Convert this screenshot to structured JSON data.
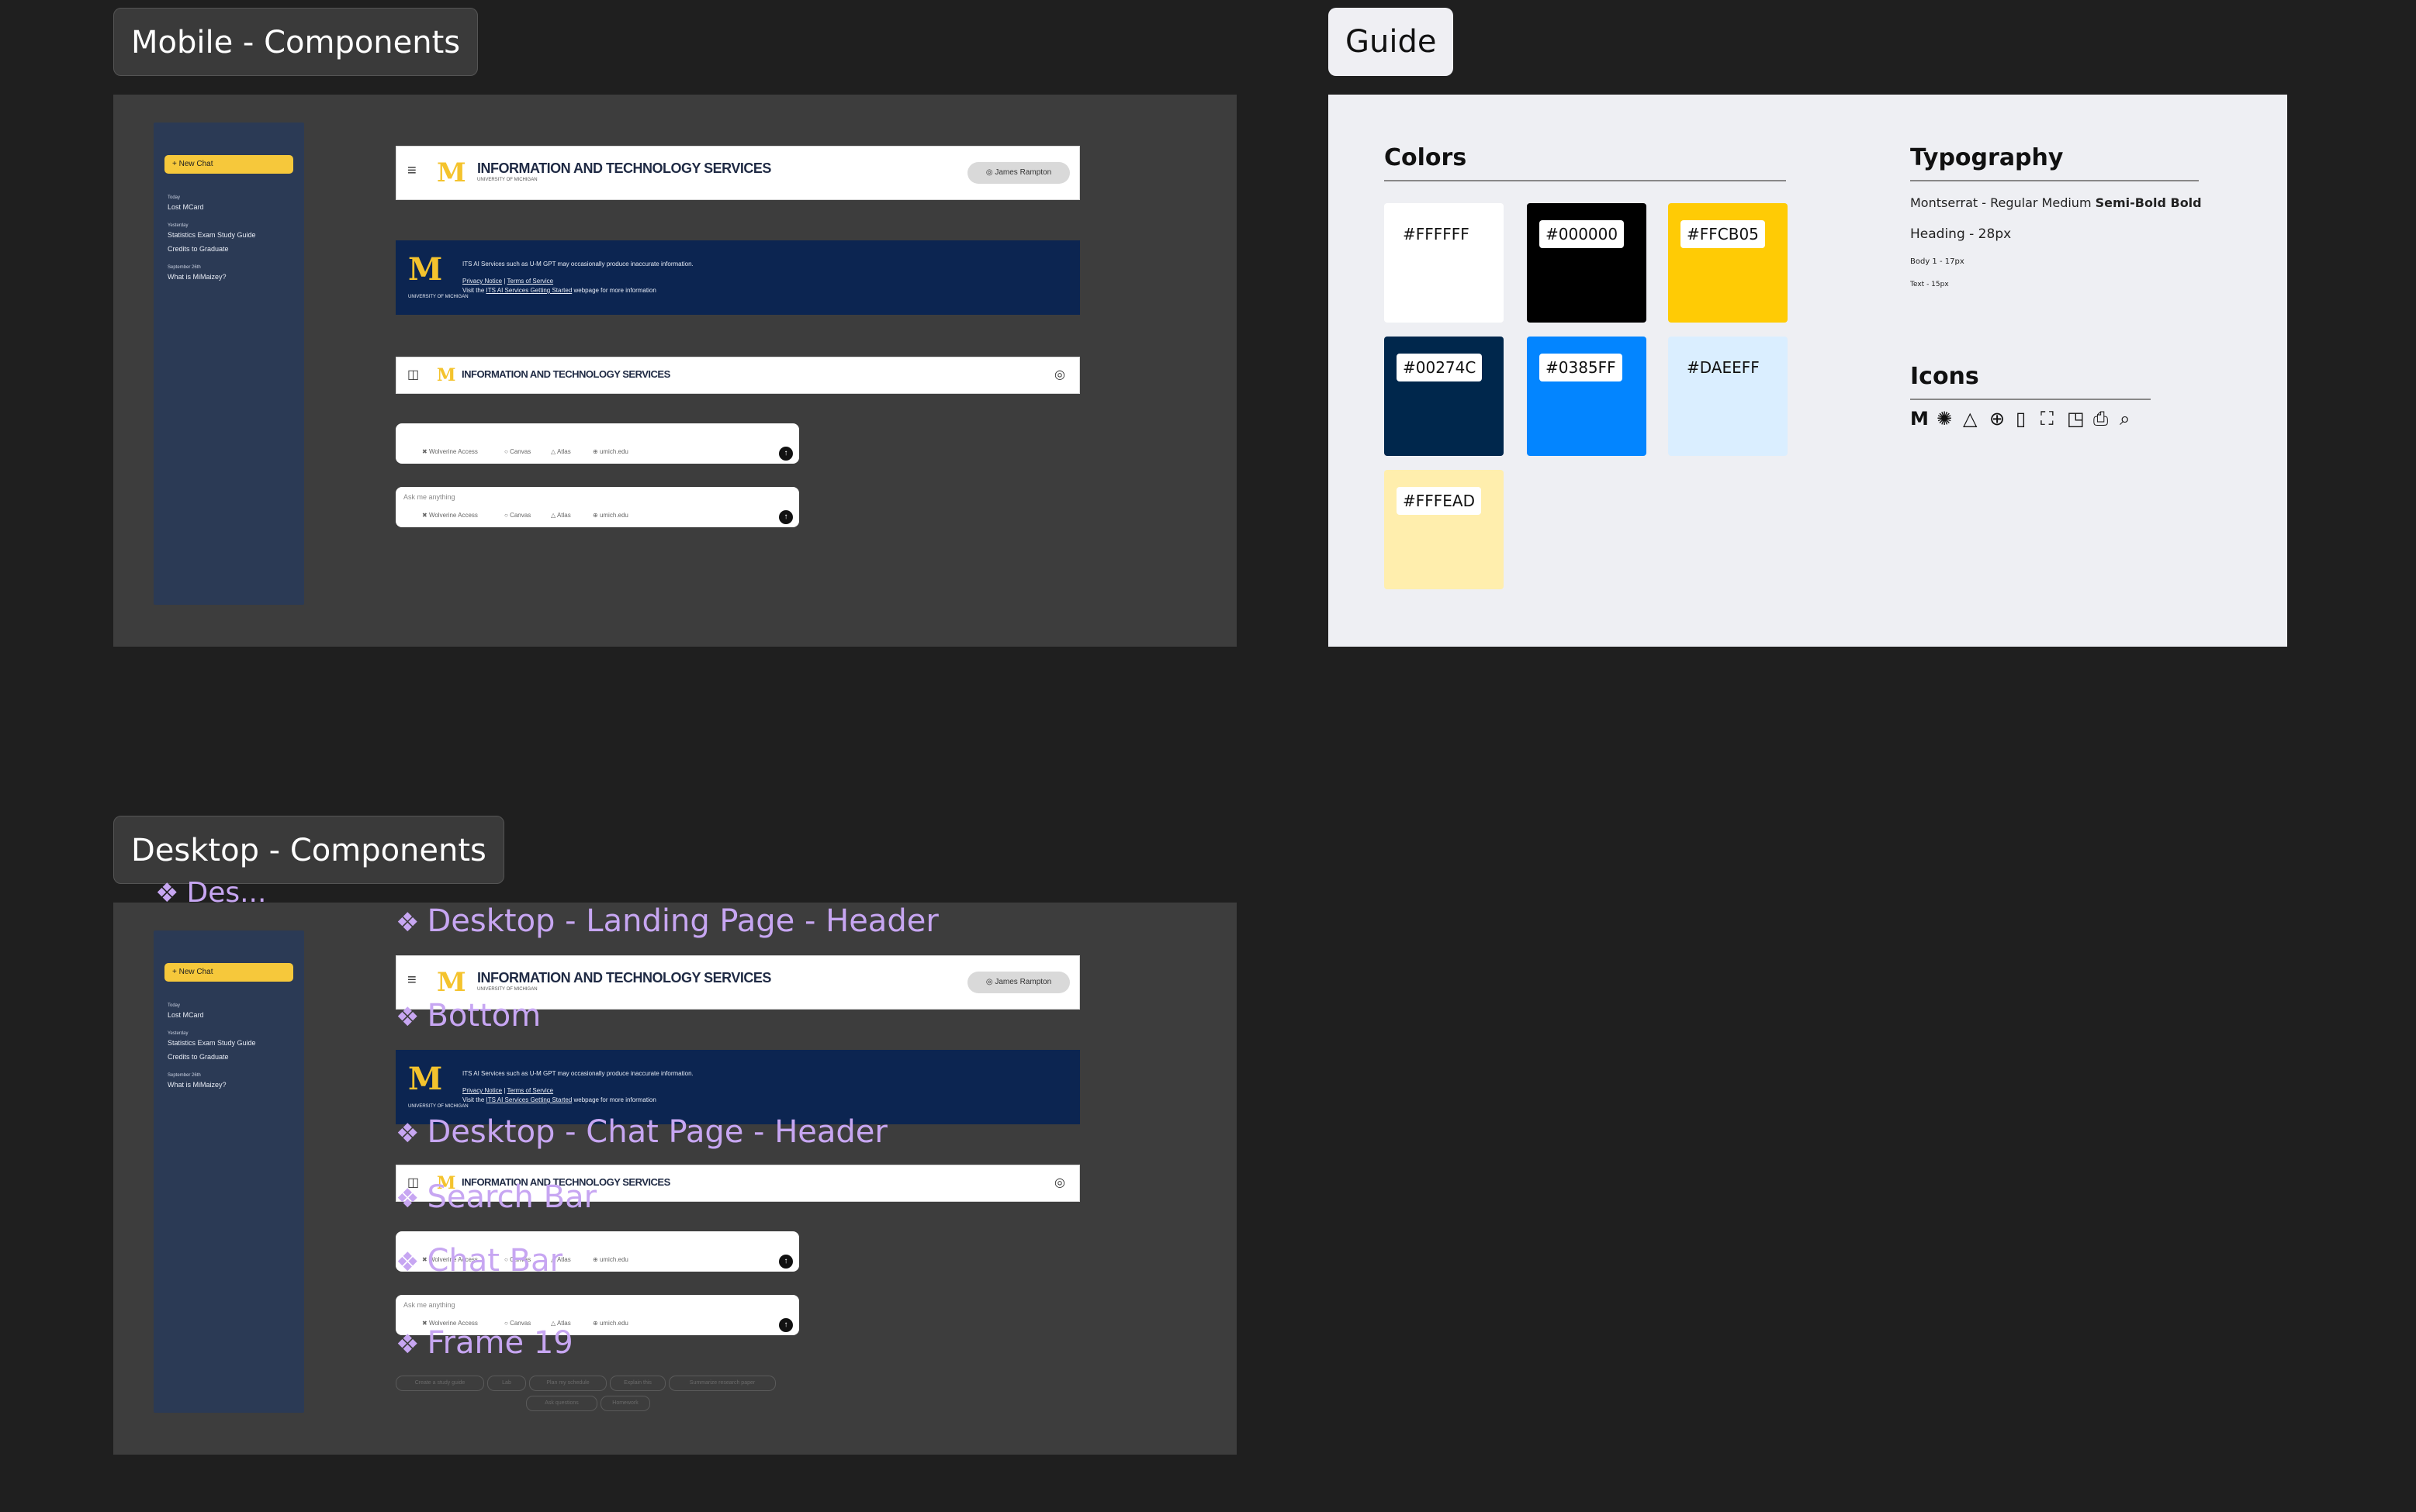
{
  "frames": {
    "mobile_label": "Mobile - Components",
    "guide_label": "Guide",
    "desktop_label": "Desktop - Components"
  },
  "sidebar": {
    "new_chat": "+  New Chat",
    "groups": [
      {
        "heading": "Today",
        "items": [
          "Lost MCard"
        ]
      },
      {
        "heading": "Yesterday",
        "items": [
          "Statistics Exam Study Guide",
          "Credits to Graduate"
        ]
      },
      {
        "heading": "September 26th",
        "items": [
          "What is MiMaizey?"
        ]
      }
    ]
  },
  "header": {
    "menu_icon": "hamburger-icon",
    "logo": "M",
    "title": "INFORMATION AND TECHNOLOGY SERVICES",
    "subtitle": "UNIVERSITY OF MICHIGAN",
    "user": "James Rampton"
  },
  "banner": {
    "logo": "M",
    "logo_sub": "UNIVERSITY OF MICHIGAN",
    "line1": "ITS AI Services such as U-M GPT may occasionally produce inaccurate information.",
    "privacy": "Privacy Notice",
    "sep": " | ",
    "terms": "Terms of Service",
    "visit_prefix": "Visit the ",
    "visit_link": "ITS AI Services Getting Started",
    "visit_suffix": " webpage for more information"
  },
  "chat_header": {
    "title": "INFORMATION AND TECHNOLOGY SERVICES"
  },
  "chatbar": {
    "placeholder": "Ask me anything",
    "chips": [
      "Wolverine Access",
      "Canvas",
      "Atlas",
      "umich.edu"
    ],
    "send_icon": "arrow-up-icon"
  },
  "components": {
    "des": "Des...",
    "landing_header": "Desktop - Landing Page - Header",
    "bottom": "Bottom",
    "chat_header": "Desktop - Chat Page - Header",
    "search_bar": "Search Bar",
    "chat_bar": "Chat Bar",
    "frame19": "Frame 19"
  },
  "frame19_pills": [
    "Create a study guide",
    "Lab",
    "Plan my schedule",
    "Explain this",
    "Summarize research paper",
    "Ask questions",
    "Homework"
  ],
  "guide": {
    "colors_heading": "Colors",
    "typography_heading": "Typography",
    "icons_heading": "Icons",
    "colors": [
      {
        "hex": "#FFFFFF",
        "swatch": "#FFFFFF"
      },
      {
        "hex": "#000000",
        "swatch": "#000000"
      },
      {
        "hex": "#FFCB05",
        "swatch": "#FFCB05"
      },
      {
        "hex": "#00274C",
        "swatch": "#00274C"
      },
      {
        "hex": "#0385FF",
        "swatch": "#0385FF"
      },
      {
        "hex": "#DAEEFF",
        "swatch": "#DAEEFF"
      },
      {
        "hex": "#FFFEAD",
        "swatch": "#FFEEAD"
      }
    ],
    "typography": {
      "family_line_prefix": "Montserrat - Regular ",
      "medium": "Medium",
      "semibold_bold": "Semi-Bold Bold",
      "heading": "Heading - 28px",
      "body": "Body 1 - 17px",
      "text": "Text - 15px"
    },
    "icons": [
      "michigan-m-icon",
      "spark-icon",
      "atlas-icon",
      "globe-icon",
      "book-icon",
      "scan-icon",
      "tag-icon",
      "printer-icon",
      "search-doc-icon"
    ]
  }
}
